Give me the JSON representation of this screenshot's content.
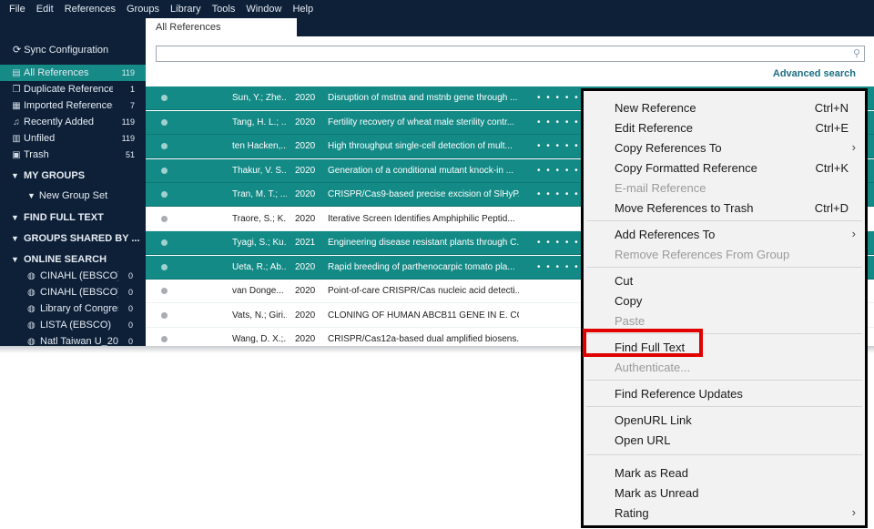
{
  "menubar": {
    "items": [
      "File",
      "Edit",
      "References",
      "Groups",
      "Library",
      "Tools",
      "Window",
      "Help"
    ]
  },
  "tab": {
    "label": "All References"
  },
  "sidebar": {
    "sync": "Sync Configuration",
    "library_items": [
      {
        "label": "All References",
        "count": "119",
        "icon": "book-icon"
      },
      {
        "label": "Duplicate References",
        "count": "1",
        "icon": "duplicate-icon"
      },
      {
        "label": "Imported References",
        "count": "7",
        "icon": "import-icon"
      },
      {
        "label": "Recently Added",
        "count": "119",
        "icon": "bell-icon"
      },
      {
        "label": "Unfiled",
        "count": "119",
        "icon": "unfiled-icon"
      },
      {
        "label": "Trash",
        "count": "51",
        "icon": "trash-icon"
      }
    ],
    "my_groups": "MY GROUPS",
    "new_group_set": "New Group Set",
    "find_full_text": "FIND FULL TEXT",
    "groups_shared": "GROUPS SHARED BY ...",
    "online_search": "ONLINE SEARCH",
    "online_items": [
      {
        "label": "CINAHL (EBSCO)",
        "count": "0"
      },
      {
        "label": "CINAHL (EBSCO) ...",
        "count": "0"
      },
      {
        "label": "Library of Congress",
        "count": "0"
      },
      {
        "label": "LISTA (EBSCO)",
        "count": "0"
      },
      {
        "label": "Natl Taiwan U_20...",
        "count": "0"
      }
    ]
  },
  "search": {
    "placeholder": "",
    "advanced_label": "Advanced search"
  },
  "references": [
    {
      "author": "Sun, Y.; Zhe...",
      "year": "2020",
      "title": "Disruption of mstna and mstnb gene through ...",
      "rating": "• • • • •",
      "selected": true
    },
    {
      "author": "Tang, H. L.; ...",
      "year": "2020",
      "title": "Fertility recovery of wheat male sterility contr...",
      "rating": "• • • • •",
      "selected": true
    },
    {
      "author": "ten Hacken,...",
      "year": "2020",
      "title": "High throughput single-cell detection of mult...",
      "rating": "• • • • •",
      "selected": true
    },
    {
      "author": "Thakur, V. S...",
      "year": "2020",
      "title": "Generation of a conditional mutant knock-in ...",
      "rating": "• • • • •",
      "selected": true
    },
    {
      "author": "Tran, M. T.; ...",
      "year": "2020",
      "title": "CRISPR/Cas9-based precise excision of SlHyP...",
      "rating": "• • • • •",
      "selected": true
    },
    {
      "author": "Traore, S.; K...",
      "year": "2020",
      "title": "Iterative Screen Identifies Amphiphilic Peptid...",
      "rating": "",
      "selected": false
    },
    {
      "author": "Tyagi, S.; Ku...",
      "year": "2021",
      "title": "Engineering disease resistant plants through C...",
      "rating": "• • • • •",
      "selected": true
    },
    {
      "author": "Ueta, R.; Ab...",
      "year": "2020",
      "title": "Rapid breeding of parthenocarpic tomato pla...",
      "rating": "• • • • •",
      "selected": true
    },
    {
      "author": "van Donge...",
      "year": "2020",
      "title": "Point-of-care CRISPR/Cas nucleic acid detecti...",
      "rating": "",
      "selected": false
    },
    {
      "author": "Vats, N.; Giri...",
      "year": "2020",
      "title": "CLONING OF HUMAN ABCB11 GENE IN E. CO...",
      "rating": "",
      "selected": false
    },
    {
      "author": "Wang, D. X.;...",
      "year": "2020",
      "title": "CRISPR/Cas12a-based dual amplified biosens...",
      "rating": "",
      "selected": false
    }
  ],
  "context_menu": {
    "new_reference": {
      "label": "New Reference",
      "shortcut": "Ctrl+N"
    },
    "edit_reference": {
      "label": "Edit Reference",
      "shortcut": "Ctrl+E"
    },
    "copy_references_to": {
      "label": "Copy References To"
    },
    "copy_formatted": {
      "label": "Copy Formatted Reference",
      "shortcut": "Ctrl+K"
    },
    "email_reference": {
      "label": "E-mail Reference"
    },
    "move_to_trash": {
      "label": "Move References to Trash",
      "shortcut": "Ctrl+D"
    },
    "add_references_to": {
      "label": "Add References To"
    },
    "remove_from_group": {
      "label": "Remove References From Group"
    },
    "cut": {
      "label": "Cut"
    },
    "copy": {
      "label": "Copy"
    },
    "paste": {
      "label": "Paste"
    },
    "find_full_text": {
      "label": "Find Full Text"
    },
    "authenticate": {
      "label": "Authenticate..."
    },
    "find_updates": {
      "label": "Find Reference Updates"
    },
    "openurl_link": {
      "label": "OpenURL Link"
    },
    "open_url": {
      "label": "Open URL"
    },
    "mark_read": {
      "label": "Mark as Read"
    },
    "mark_unread": {
      "label": "Mark as Unread"
    },
    "rating": {
      "label": "Rating"
    }
  },
  "colors": {
    "sidebar_bg": "#0d2038",
    "selection": "#138a86",
    "highlight": "#e00000"
  }
}
